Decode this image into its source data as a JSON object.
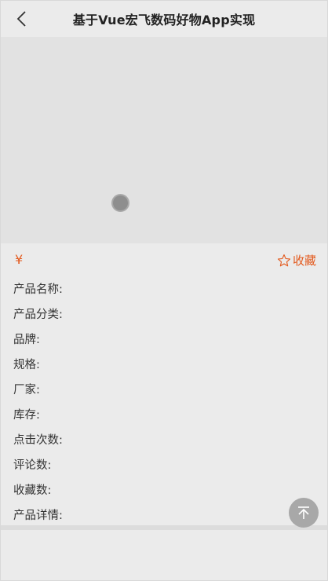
{
  "header": {
    "title": "基于Vue宏飞数码好物App实现",
    "back_icon": "chevron-left-icon"
  },
  "product": {
    "price_symbol": "¥",
    "favorite_label": "收藏",
    "favorite_icon": "star-outline-icon",
    "accent_color": "#e35a1e"
  },
  "info_fields": [
    {
      "label": "产品名称:"
    },
    {
      "label": "产品分类:"
    },
    {
      "label": "品牌:"
    },
    {
      "label": "规格:"
    },
    {
      "label": "厂家:"
    },
    {
      "label": "库存:"
    },
    {
      "label": "点击次数:"
    },
    {
      "label": "评论数:"
    },
    {
      "label": "收藏数:"
    },
    {
      "label": "产品详情:"
    }
  ],
  "back_to_top_icon": "arrow-up-to-top-icon"
}
